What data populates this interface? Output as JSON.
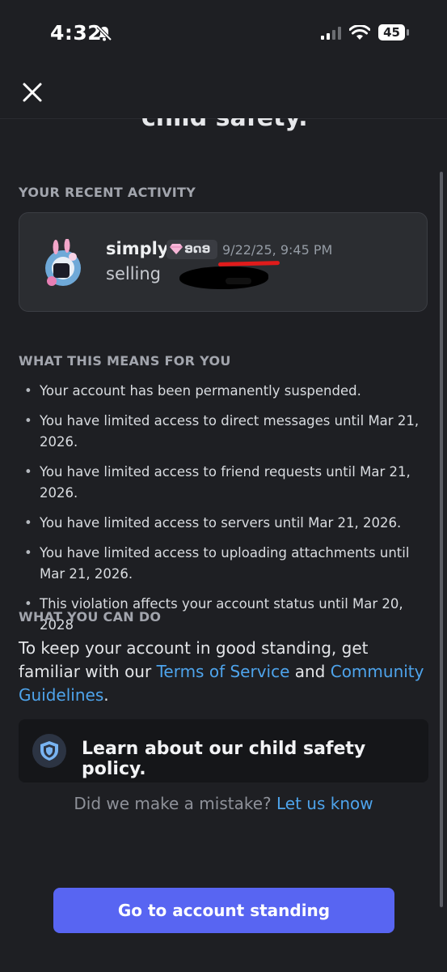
{
  "status_bar": {
    "time": "4:32",
    "battery": "45"
  },
  "header": {
    "cut_heading": "child safety."
  },
  "recent_activity": {
    "label": "YOUR RECENT ACTIVITY",
    "username": "simply",
    "tag": "ອດອ",
    "timestamp": "9/22/25, 9:45 PM",
    "message": "selling"
  },
  "what_this_means": {
    "label": "WHAT THIS MEANS FOR YOU",
    "items": [
      "Your account has been permanently suspended.",
      "You have limited access to direct messages until Mar 21, 2026.",
      "You have limited access to friend requests until Mar 21, 2026.",
      "You have limited access to servers until Mar 21, 2026.",
      "You have limited access to uploading attachments until Mar 21, 2026.",
      "This violation affects your account status until Mar 20, 2028"
    ]
  },
  "what_you_can_do": {
    "label": "WHAT YOU CAN DO",
    "text_before": "To keep your account in good standing, get familiar with our ",
    "terms_link": "Terms of Service",
    "and": " and ",
    "guidelines_link": "Community Guidelines",
    "end": "."
  },
  "policy_card": {
    "text": "Learn about our child safety policy.",
    "icon": "shield-icon"
  },
  "mistake": {
    "question": "Did we make a mistake? ",
    "link": "Let us know"
  },
  "cta": {
    "label": "Go to account standing"
  },
  "colors": {
    "accent": "#5865f2",
    "link": "#4ea4ec",
    "background": "#1e1f23",
    "card": "#2b2d31",
    "highlight": "#e01b1b"
  }
}
